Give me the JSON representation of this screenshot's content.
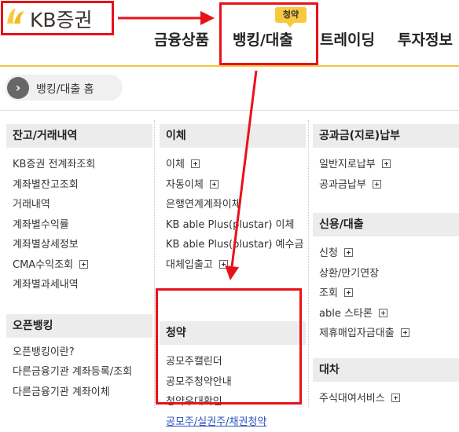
{
  "header": {
    "logo_text": "KB증권",
    "badge": "청약",
    "nav": [
      "금융상품",
      "뱅킹/대출",
      "트레이딩",
      "투자정보"
    ]
  },
  "breadcrumb": {
    "label": "뱅킹/대출 홈"
  },
  "columns": {
    "col1": {
      "sec1": {
        "title": "잔고/거래내역",
        "items": [
          "KB증권 전계좌조회",
          "계좌별잔고조회",
          "거래내역",
          "계좌별수익률",
          "계좌별상세정보",
          "CMA수익조회",
          "계좌별과세내역"
        ]
      },
      "sec2": {
        "title": "오픈뱅킹",
        "items": [
          "오픈뱅킹이란?",
          "다른금융기관 계좌등록/조회",
          "다른금융기관 계좌이체"
        ]
      }
    },
    "col2": {
      "sec1": {
        "title": "이체",
        "items": [
          "이체",
          "자동이체",
          "은행연계계좌이체",
          "KB able Plus(plustar) 이체",
          "KB able Plus(plustar) 예수금",
          "대체입출고"
        ]
      },
      "sec2": {
        "title": "청약",
        "items": [
          "공모주캘린더",
          "공모주청약안내",
          "청약우대확인",
          "공모주/실권주/채권청약"
        ]
      }
    },
    "col3": {
      "sec1": {
        "title": "공과금(지로)납부",
        "items": [
          "일반지로납부",
          "공과금납부"
        ]
      },
      "sec2": {
        "title": "신용/대출",
        "items": [
          "신청",
          "상환/만기연장",
          "조회",
          "able 스타론",
          "제휴매입자금대출"
        ]
      },
      "sec3": {
        "title": "대차",
        "items": [
          "주식대여서비스"
        ]
      }
    }
  },
  "colors": {
    "accent_red": "#e8111b",
    "header_line": "#f1c43f",
    "badge": "#f7c93c"
  }
}
